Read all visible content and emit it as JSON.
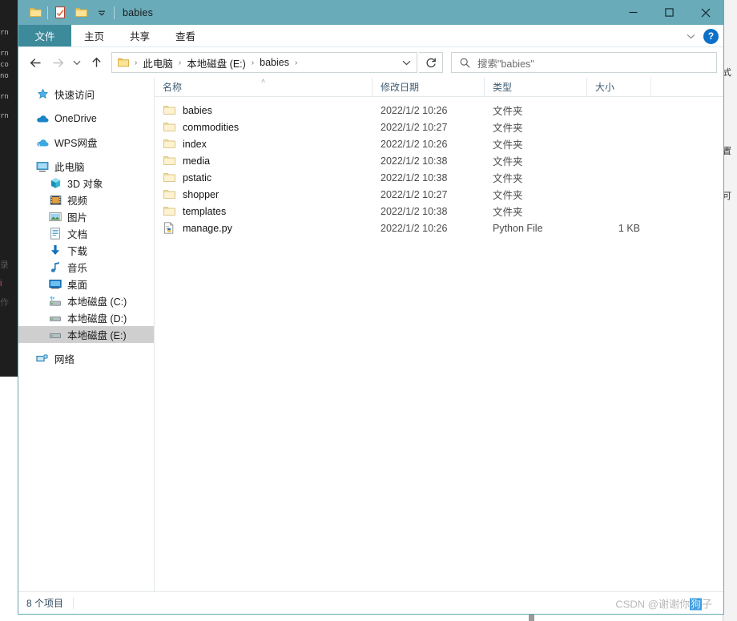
{
  "window": {
    "title": "babies",
    "quick_access": [
      {
        "name": "folder-icon",
        "label": "folder"
      },
      {
        "name": "properties-icon",
        "label": "properties"
      },
      {
        "name": "new-folder-icon",
        "label": "new folder"
      },
      {
        "name": "chevron-down-icon",
        "label": "customize quick access toolbar"
      }
    ],
    "controls": {
      "minimize": "—",
      "maximize": "☐",
      "close": "✕"
    },
    "titlebar_color": "#69abb9"
  },
  "ribbon": {
    "file_tab": "文件",
    "tabs": [
      {
        "label": "主页"
      },
      {
        "label": "共享"
      },
      {
        "label": "查看"
      }
    ],
    "collapse_icon": "∨",
    "help_label": "?",
    "file_tab_color": "#3d8a9b"
  },
  "navigation": {
    "back_icon": "←",
    "forward_icon": "→",
    "recent_icon": "∨",
    "up_icon": "↑",
    "address_dropdown_icon": "∨",
    "refresh_icon": "↻",
    "breadcrumbs": [
      {
        "label": "此电脑"
      },
      {
        "label": "本地磁盘 (E:)"
      },
      {
        "label": "babies"
      }
    ],
    "separator": "›"
  },
  "search": {
    "icon": "search-icon",
    "placeholder": "搜索\"babies\""
  },
  "sidebar": {
    "items": [
      {
        "label": "快速访问",
        "icon": "star-icon",
        "indent": false,
        "group": false,
        "selected": false
      },
      {
        "label": "OneDrive",
        "icon": "cloud-icon",
        "indent": false,
        "group": true,
        "selected": false
      },
      {
        "label": "WPS网盘",
        "icon": "cloud-icon",
        "indent": false,
        "group": true,
        "selected": false
      },
      {
        "label": "此电脑",
        "icon": "monitor-icon",
        "indent": false,
        "group": true,
        "selected": false
      },
      {
        "label": "3D 对象",
        "icon": "cube-icon",
        "indent": true,
        "group": false,
        "selected": false
      },
      {
        "label": "视频",
        "icon": "video-icon",
        "indent": true,
        "group": false,
        "selected": false
      },
      {
        "label": "图片",
        "icon": "picture-icon",
        "indent": true,
        "group": false,
        "selected": false
      },
      {
        "label": "文档",
        "icon": "document-icon",
        "indent": true,
        "group": false,
        "selected": false
      },
      {
        "label": "下载",
        "icon": "download-icon",
        "indent": true,
        "group": false,
        "selected": false
      },
      {
        "label": "音乐",
        "icon": "music-icon",
        "indent": true,
        "group": false,
        "selected": false
      },
      {
        "label": "桌面",
        "icon": "desktop-icon",
        "indent": true,
        "group": false,
        "selected": false
      },
      {
        "label": "本地磁盘 (C:)",
        "icon": "system-drive-icon",
        "indent": true,
        "group": false,
        "selected": false
      },
      {
        "label": "本地磁盘 (D:)",
        "icon": "drive-icon",
        "indent": true,
        "group": false,
        "selected": false
      },
      {
        "label": "本地磁盘 (E:)",
        "icon": "drive-icon",
        "indent": true,
        "group": false,
        "selected": true
      },
      {
        "label": "网络",
        "icon": "network-icon",
        "indent": false,
        "group": true,
        "selected": false
      }
    ]
  },
  "file_list": {
    "columns": [
      {
        "label": "名称",
        "key": "name",
        "sorted": "asc"
      },
      {
        "label": "修改日期",
        "key": "date",
        "sorted": ""
      },
      {
        "label": "类型",
        "key": "type",
        "sorted": ""
      },
      {
        "label": "大小",
        "key": "size",
        "sorted": ""
      }
    ],
    "sort_caret": "˄",
    "rows": [
      {
        "name": "babies",
        "date": "2022/1/2 10:26",
        "type": "文件夹",
        "size": "",
        "icon": "folder-icon"
      },
      {
        "name": "commodities",
        "date": "2022/1/2 10:27",
        "type": "文件夹",
        "size": "",
        "icon": "folder-icon"
      },
      {
        "name": "index",
        "date": "2022/1/2 10:26",
        "type": "文件夹",
        "size": "",
        "icon": "folder-icon"
      },
      {
        "name": "media",
        "date": "2022/1/2 10:38",
        "type": "文件夹",
        "size": "",
        "icon": "folder-icon"
      },
      {
        "name": "pstatic",
        "date": "2022/1/2 10:38",
        "type": "文件夹",
        "size": "",
        "icon": "folder-icon"
      },
      {
        "name": "shopper",
        "date": "2022/1/2 10:27",
        "type": "文件夹",
        "size": "",
        "icon": "folder-icon"
      },
      {
        "name": "templates",
        "date": "2022/1/2 10:38",
        "type": "文件夹",
        "size": "",
        "icon": "folder-icon"
      },
      {
        "name": "manage.py",
        "date": "2022/1/2 10:26",
        "type": "Python File",
        "size": "1 KB",
        "icon": "python-file-icon"
      }
    ]
  },
  "status": {
    "item_count": "8 个项目"
  },
  "watermark": {
    "prefix": "CSDN @谢谢你",
    "selected": "狗",
    "suffix": "子"
  },
  "background": {
    "left_fragments": [
      "rn",
      "rn",
      "co",
      "no",
      "rn",
      "rn"
    ],
    "left_light_fragments": [
      "录",
      "i",
      "作"
    ],
    "right_fragments": [
      "式",
      "置",
      "可"
    ]
  }
}
